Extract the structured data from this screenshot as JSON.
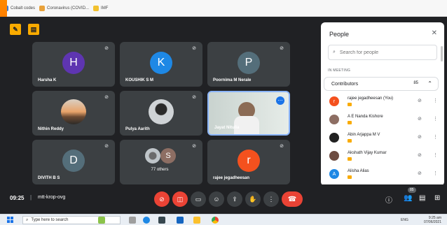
{
  "browser": {
    "bookmarks": [
      {
        "label": "Cobalt codes",
        "color": "#3b7bd6"
      },
      {
        "label": "Coronavirus (COVID...",
        "color": "#e8a13a"
      },
      {
        "label": "IMF",
        "color": "#f2c12e"
      }
    ]
  },
  "meeting": {
    "time": "09:25",
    "separator": "|",
    "code": "mtt-krop-ovg",
    "tiles": [
      {
        "name": "Harsha K",
        "initial": "H",
        "color": "#5e35b1"
      },
      {
        "name": "KOUSHIK S M",
        "initial": "K",
        "color": "#1e88e5"
      },
      {
        "name": "Poornima M Nerale",
        "initial": "P",
        "color": "#546e7a"
      },
      {
        "name": "Nithin Reddy",
        "initial": "",
        "color": ""
      },
      {
        "name": "Pulya Aarith",
        "initial": "",
        "color": ""
      },
      {
        "name": "Jayat Nitulia",
        "initial": "",
        "color": ""
      },
      {
        "name": "DIVITH B S",
        "initial": "D",
        "color": "#546e7a"
      },
      {
        "name": "77 others",
        "initial": "",
        "color": ""
      },
      {
        "name": "rajee jegadheesan",
        "initial": "r",
        "color": "#f4511e"
      }
    ],
    "others_initial": "S",
    "participants_badge": "85"
  },
  "people_panel": {
    "title": "People",
    "search_placeholder": "Search for people",
    "section_label": "IN MEETING",
    "group_label": "Contributors",
    "group_count": "85",
    "people": [
      {
        "name": "rajee jegadheesan (You)",
        "initial": "r",
        "color": "#f4511e"
      },
      {
        "name": "A E Nanda Kishore",
        "initial": "",
        "color": "#8d6e63"
      },
      {
        "name": "Abin Arjappa M V",
        "initial": "",
        "color": "#212121"
      },
      {
        "name": "Akshath Vijay Kumar",
        "initial": "",
        "color": "#6d4c41"
      },
      {
        "name": "Alisha Alias",
        "initial": "A",
        "color": "#1e88e5"
      }
    ]
  },
  "taskbar": {
    "search_placeholder": "Type here to search",
    "language": "ENG",
    "clock": "9:25 am",
    "date": "07/06/2021"
  },
  "colors": {
    "meet_bg": "#202124",
    "tile_bg": "#3c4043",
    "hangup": "#ea4335",
    "accent": "#1a73e8",
    "host_tag": "#f9ab00"
  }
}
